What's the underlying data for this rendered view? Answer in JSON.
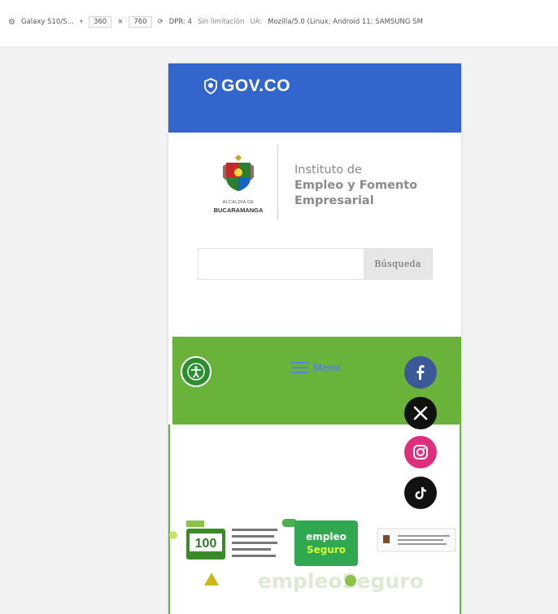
{
  "devtools": {
    "device": "Galaxy S10/S...",
    "width": "360",
    "times": "×",
    "height": "760",
    "dpr": "DPR: 4",
    "throttle": "Sin limitación",
    "ua_label": "UA:",
    "ua": "Mozilla/5.0 (Linux; Android 11; SAMSUNG SM"
  },
  "gov": {
    "brand": "GOV.CO"
  },
  "header": {
    "city_label_top": "ALCALDÍA DE",
    "city_label": "BUCARAMANGA",
    "inst_line1": "Instituto de",
    "inst_line2": "Empleo y Fomento",
    "inst_line3": "Empresarial"
  },
  "search": {
    "placeholder": "",
    "value": "",
    "button_label": "Búsqueda"
  },
  "nav": {
    "menu_label": "Menu"
  },
  "banner": {
    "counter_value": "100",
    "logo_top": "empleo",
    "logo_bottom": "Seguro",
    "watermark": "empleoSeguro"
  },
  "social": [
    "facebook-icon",
    "x-icon",
    "instagram-icon",
    "tiktok-icon"
  ],
  "colors": {
    "gov_blue": "#3366cc",
    "green": "#6ab33a",
    "accessibility_green": "#2c8e2c",
    "menu_blue": "#5f7fe0"
  }
}
